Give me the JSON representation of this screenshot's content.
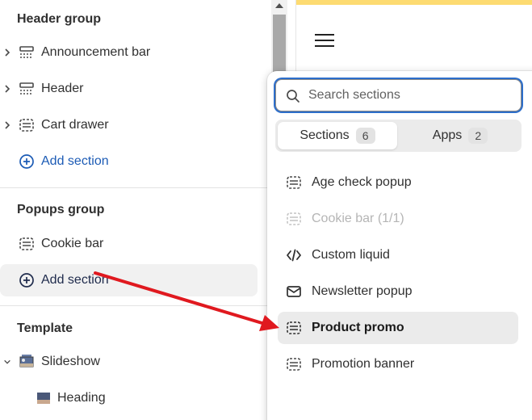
{
  "sidebar": {
    "header_group": {
      "title": "Header group",
      "items": [
        {
          "label": "Announcement bar"
        },
        {
          "label": "Header"
        },
        {
          "label": "Cart drawer"
        }
      ],
      "add_label": "Add section"
    },
    "popups_group": {
      "title": "Popups group",
      "items": [
        {
          "label": "Cookie bar"
        }
      ],
      "add_label": "Add section"
    },
    "template": {
      "title": "Template",
      "items": [
        {
          "label": "Slideshow"
        },
        {
          "label": "Heading"
        }
      ]
    }
  },
  "popover": {
    "search_placeholder": "Search sections",
    "tabs": [
      {
        "label": "Sections",
        "count": "6"
      },
      {
        "label": "Apps",
        "count": "2"
      }
    ],
    "items": [
      {
        "label": "Age check popup",
        "icon": "section-icon"
      },
      {
        "label": "Cookie bar (1/1)",
        "icon": "section-icon"
      },
      {
        "label": "Custom liquid",
        "icon": "code-icon"
      },
      {
        "label": "Newsletter popup",
        "icon": "envelope-icon"
      },
      {
        "label": "Product promo",
        "icon": "section-icon"
      },
      {
        "label": "Promotion banner",
        "icon": "section-icon"
      }
    ]
  },
  "colors": {
    "accent_link": "#1c5bb5",
    "focus_ring": "#2c6ecb",
    "annotation_arrow": "#e0191f",
    "preview_top_bar": "#fddb72"
  }
}
